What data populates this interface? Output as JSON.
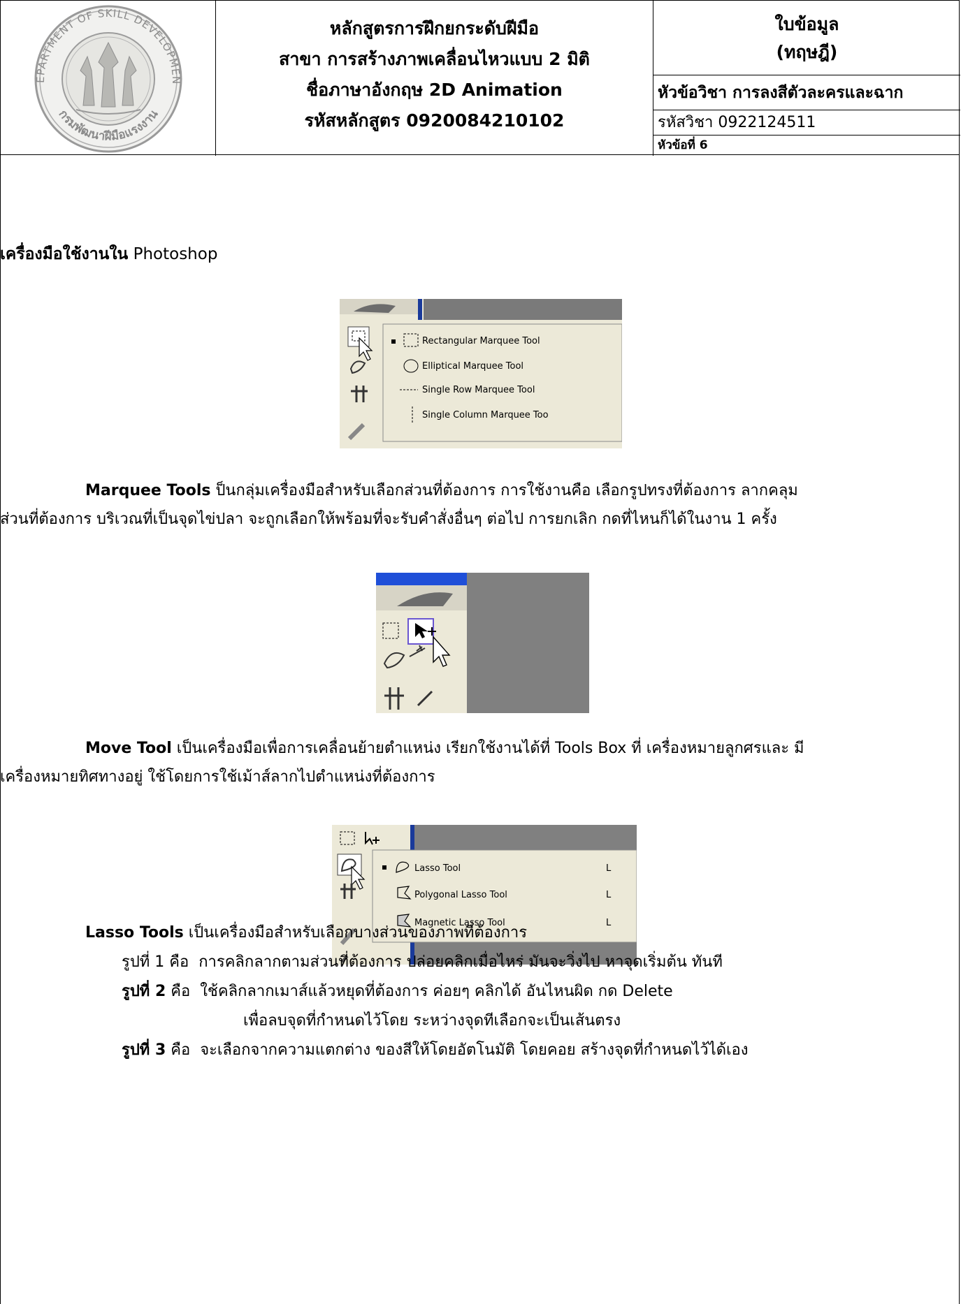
{
  "header": {
    "logo": {
      "ring_text_top": "DEPARTMENT OF SKILL DEVELOPMENT",
      "ring_text_bottom": "กรมพัฒนาฝีมือแรงงาน"
    },
    "title_lines": [
      "หลักสูตรการฝึกยกระดับฝีมือ",
      "สาขา การสร้างภาพเคลื่อนไหวแบบ 2 มิติ",
      "ชื่อภาษาอังกฤษ 2D Animation",
      "รหัสหลักสูตร 0920084210102"
    ],
    "sheet_type_line1": "ใบข้อมูล",
    "sheet_type_line2": "(ทฤษฎี)",
    "subject": "หัวข้อวิชา การลงสีตัวละครและฉาก",
    "subject_code": "รหัสวิชา 0922124511",
    "topic_no": "หัวข้อที่ 6"
  },
  "content": {
    "heading_bold": "เครื่องมือใช้งานใน",
    "heading_rest": " Photoshop",
    "marquee_menu": {
      "items": [
        "Rectangular Marquee Tool",
        "Elliptical Marquee Tool",
        "Single Row Marquee Tool",
        "Single Column Marquee Too"
      ]
    },
    "marquee_para": {
      "term": "Marquee Tools",
      "line1_rest": " ป็นกลุ่มเครื่องมือสำหรับเลือกส่วนที่ต้องการ การใช้งานคือ เลือกรูปทรงที่ต้องการ ลากคลุม",
      "line2": "ส่วนที่ต้องการ บริเวณที่เป็นจุดไข่ปลา จะถูกเลือกให้พร้อมที่จะรับคำสั่งอื่นๆ ต่อไป การยกเลิก กดที่ไหนก็ได้ในงาน 1 ครั้ง"
    },
    "move_para": {
      "term": "Move Tool",
      "line1_rest": " เป็นเครื่องมือเพื่อการเคลื่อนย้ายตำแหน่ง เรียกใช้งานได้ที่ Tools Box ที่ เครื่องหมายลูกศรและ มี",
      "line2": "เครื่องหมายทิศทางอยู่ ใช้โดยการใช้เม้าส์ลากไปตำแหน่งที่ต้องการ"
    },
    "lasso_menu": {
      "items": [
        "Lasso Tool",
        "Polygonal Lasso Tool",
        "Magnetic Lasso Tool"
      ],
      "shortcut": "L"
    },
    "lasso": {
      "term": "Lasso Tools",
      "intro_rest": " เป็นเครื่องมือสำหรับเลือกบางส่วนของภาพที่ต้องการ",
      "fig1_label": "รูปที่ 1",
      "fig1_word": "คือ",
      "fig1_text": "การคลิกลากตามส่วนที่ต้องการ ปล่อยคลิกเมื่อไหร่ มันจะวิ่งไป หาจุดเริ่มต้น ทันที",
      "fig2_label": "รูปที่ 2",
      "fig2_word": "คือ",
      "fig2_text": "ใช้คลิกลากเมาส์แล้วหยุดที่ต้องการ ค่อยๆ คลิกได้ อันไหนผิด กด Delete",
      "fig2_cont": "เพื่อลบจุดที่กำหนดไว้โดย ระหว่างจุดทีเลือกจะเป็นเส้นตรง",
      "fig3_label": "รูปที่ 3",
      "fig3_word": "คือ",
      "fig3_text": "จะเลือกจากความแตกต่าง ของสีให้โดยอัตโนมัติ โดยคอย สร้างจุดที่กำหนดไว้ได้เอง"
    }
  },
  "colors": {
    "menu_bg": "#ece9d8",
    "canvas_gray": "#808080",
    "title_blue": "#1f4fd8"
  }
}
